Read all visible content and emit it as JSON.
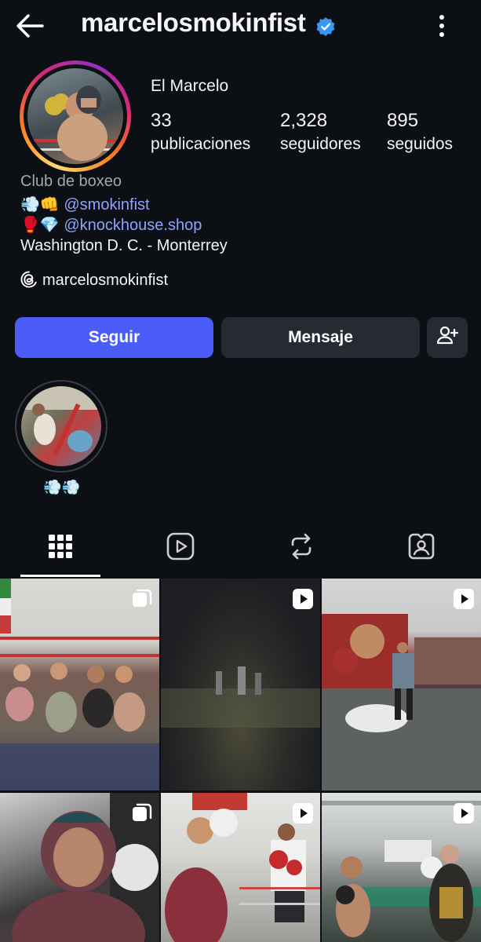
{
  "header": {
    "username": "marcelosmokinfist",
    "icons": [
      "back-arrow-icon",
      "verified-badge-icon",
      "more-vertical-icon"
    ]
  },
  "profile": {
    "full_name": "El Marcelo",
    "stats": [
      {
        "value": "33",
        "label": "publicaciones"
      },
      {
        "value": "2,328",
        "label": "seguidores"
      },
      {
        "value": "895",
        "label": "seguidos"
      }
    ],
    "category": "Club de boxeo",
    "bio_line1_emoji": "💨👊",
    "bio_line1_link": "@smokinfist",
    "bio_line2_emoji": "🥊💎",
    "bio_line2_link": "@knockhouse.shop",
    "bio_line3": "Washington D. C. - Monterrey",
    "threads_handle": "marcelosmokinfist"
  },
  "actions": {
    "follow": "Seguir",
    "message": "Mensaje"
  },
  "highlights": [
    {
      "label": "💨💨"
    }
  ],
  "tabs": [
    "grid-icon",
    "reels-icon",
    "reposts-icon",
    "tagged-icon"
  ],
  "grid": [
    {
      "type": "carousel"
    },
    {
      "type": "reel"
    },
    {
      "type": "reel"
    },
    {
      "type": "carousel"
    },
    {
      "type": "reel"
    },
    {
      "type": "reel"
    }
  ],
  "colors": {
    "background": "#0c0f14",
    "follow_button": "#4a5df9",
    "secondary_button": "#262a33",
    "link": "#8fa3ff",
    "verified": "#3897f0"
  }
}
